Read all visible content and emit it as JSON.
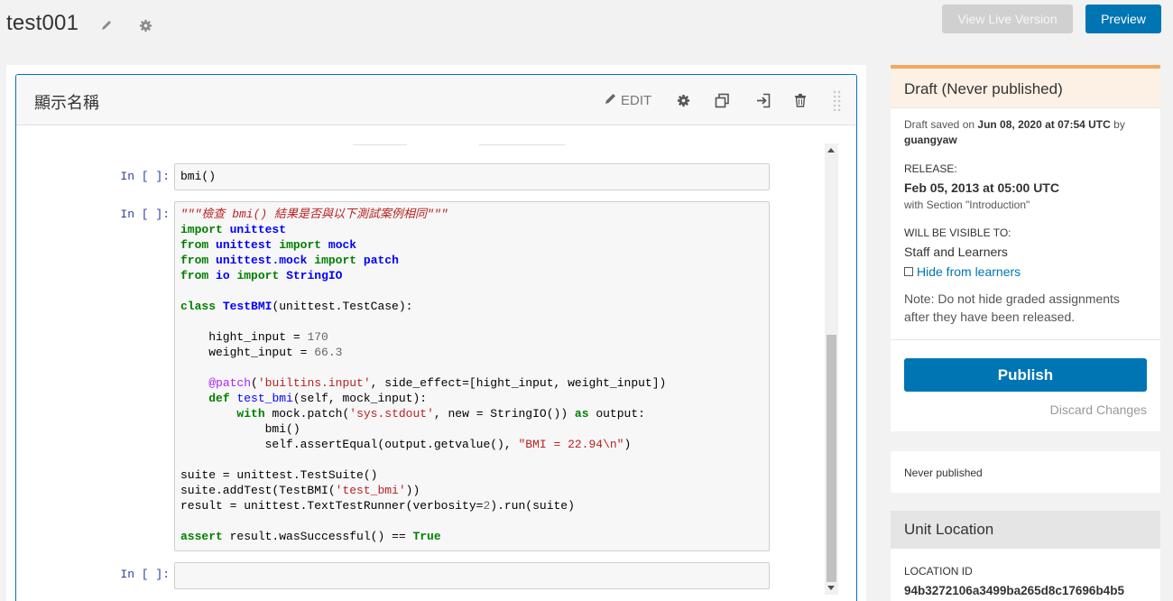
{
  "page": {
    "title": "test001",
    "view_live_label": "View Live Version",
    "preview_label": "Preview"
  },
  "xblock": {
    "title": "顯示名稱",
    "edit_label": "EDIT"
  },
  "notebook": {
    "prompt": "In [ ]:",
    "cell1_code": "bmi()",
    "cell2_lines": [
      "\"\"\"檢查 bmi() 結果是否與以下測試案例相同\"\"\"",
      "import unittest",
      "from unittest import mock",
      "from unittest.mock import patch",
      "from io import StringIO",
      "",
      "class TestBMI(unittest.TestCase):",
      "",
      "    hight_input = 170",
      "    weight_input = 66.3",
      "",
      "    @patch('builtins.input', side_effect=[hight_input, weight_input])",
      "    def test_bmi(self, mock_input):",
      "        with mock.patch('sys.stdout', new = StringIO()) as output:",
      "            bmi()",
      "            self.assertEqual(output.getvalue(), \"BMI = 22.94\\n\")",
      "",
      "suite = unittest.TestSuite()",
      "suite.addTest(TestBMI('test_bmi'))",
      "result = unittest.TextTestRunner(verbosity=2).run(suite)",
      "",
      "assert result.wasSuccessful() == True"
    ]
  },
  "status": {
    "heading": "Draft (Never published)",
    "saved_prefix": "Draft saved on",
    "saved_date": "Jun 08, 2020 at 07:54 UTC",
    "saved_by": "by",
    "saved_user": "guangyaw",
    "release_label": "RELEASE:",
    "release_date": "Feb 05, 2013 at 05:00 UTC",
    "release_section": "with Section \"Introduction\"",
    "visible_label": "WILL BE VISIBLE TO:",
    "visible_value": "Staff and Learners",
    "hide_link": "Hide from learners",
    "note": "Note: Do not hide graded assignments after they have been released.",
    "publish_label": "Publish",
    "discard_label": "Discard Changes"
  },
  "publish_info": {
    "text": "Never published"
  },
  "unit_location": {
    "heading": "Unit Location",
    "id_label": "LOCATION ID",
    "id_value": "94b3272106a3499ba265d8c17696b4b5"
  },
  "colors": {
    "accent": "#0075b4",
    "draft_bar": "#f2a85f",
    "draft_bg": "#fdf0e4"
  }
}
